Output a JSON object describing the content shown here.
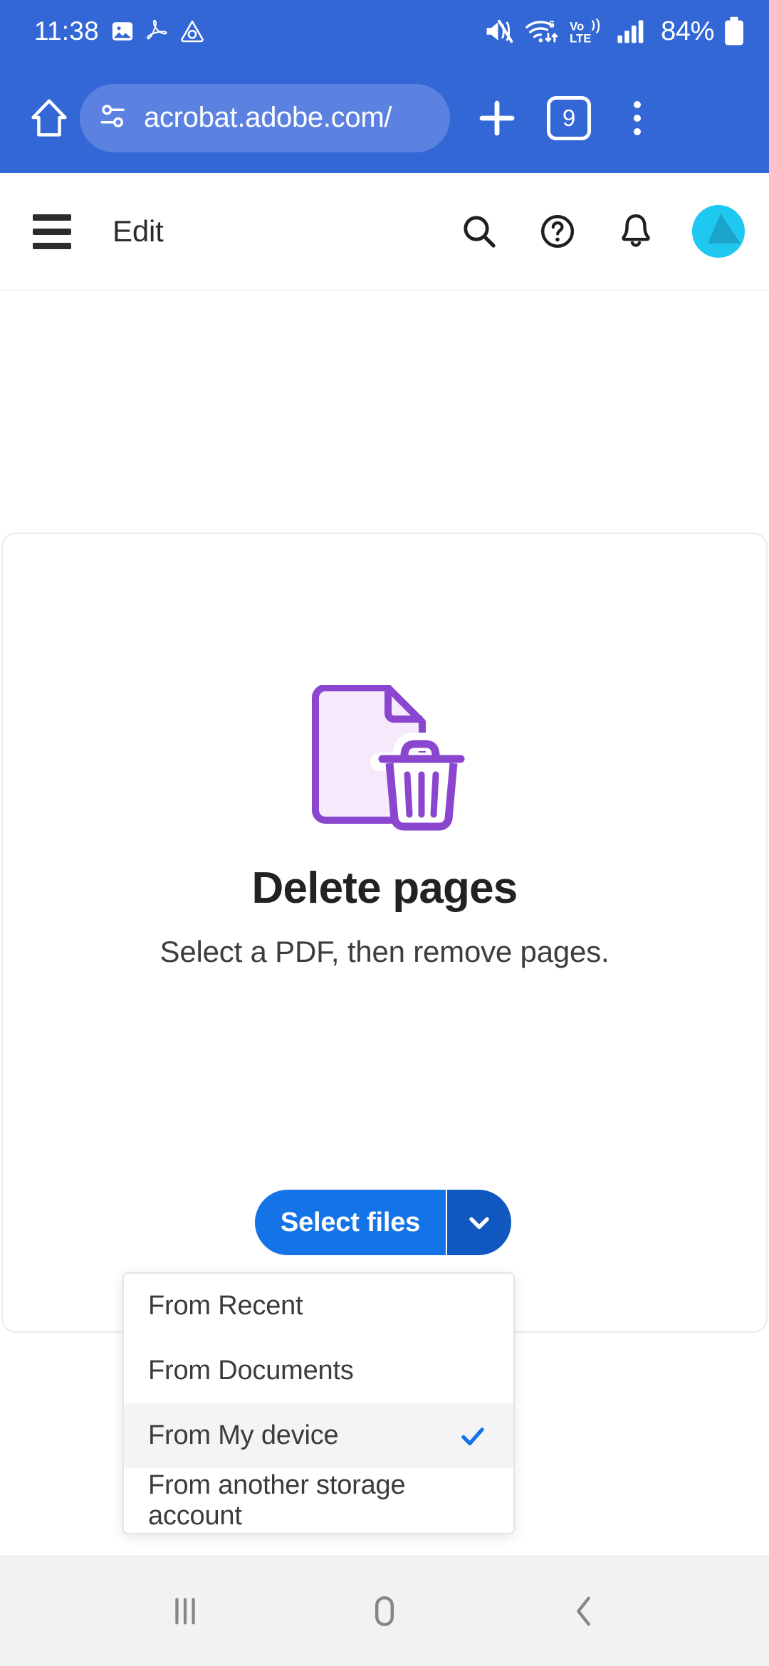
{
  "status_bar": {
    "clock": "11:38",
    "battery_percent": "84%",
    "left_icons": [
      "image-icon",
      "adobe-acrobat-icon",
      "adobe-creative-cloud-icon"
    ],
    "right_icons": [
      "mute-vibrate-icon",
      "wifi-6-icon",
      "volte-icon",
      "signal-bars-icon",
      "battery-icon"
    ],
    "wifi_label": "6",
    "volte_label_top": "Vo)",
    "volte_label_bottom": "LTE",
    "background_color": "#3367d6"
  },
  "browser": {
    "home_label": "home-icon",
    "url": "acrobat.adobe.com/",
    "site_settings_icon": "tune-icon",
    "new_tab_label": "+",
    "tab_count": "9",
    "menu_icon": "overflow-menu-icon",
    "pill_color": "#5b82e0"
  },
  "app_header": {
    "menu_icon": "hamburger-icon",
    "title": "Edit",
    "actions": [
      {
        "name": "search-icon"
      },
      {
        "name": "help-icon"
      },
      {
        "name": "notifications-bell-icon"
      }
    ],
    "avatar_color": "#1fc8f0"
  },
  "tool_card": {
    "illustration": "document-with-trash-icon",
    "illustration_accent_color": "#8b46d0",
    "illustration_fill_color": "#f5e9fb",
    "title": "Delete pages",
    "subtitle": "Select a PDF, then remove pages."
  },
  "select_files": {
    "label": "Select files",
    "dropdown_toggle_icon": "chevron-down-icon",
    "primary_color": "#1473e6",
    "toggle_color": "#1058c0"
  },
  "source_dropdown": {
    "items": [
      {
        "label": "From Recent",
        "selected": false
      },
      {
        "label": "From Documents",
        "selected": false
      },
      {
        "label": "From My device",
        "selected": true
      },
      {
        "label": "From another storage account",
        "selected": false
      }
    ],
    "check_color": "#1473e6",
    "selected_row_color": "#f4f4f4"
  },
  "android_nav": {
    "buttons": [
      {
        "name": "recents-icon"
      },
      {
        "name": "home-icon"
      },
      {
        "name": "back-icon"
      }
    ]
  }
}
